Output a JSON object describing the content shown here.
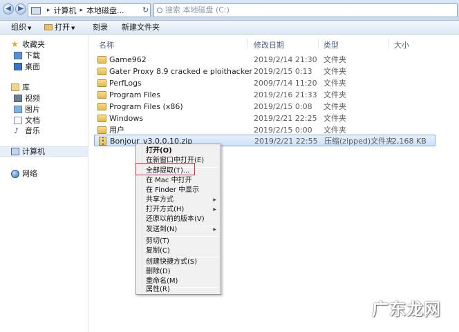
{
  "address_bar": {
    "path": [
      "计算机",
      "本地磁盘..."
    ],
    "search_placeholder": "搜索 本地磁盘 (C:)"
  },
  "toolbar": {
    "organize": "组织",
    "open": "打开",
    "burn": "刻录",
    "new_folder": "新建文件夹"
  },
  "nav": {
    "favorites": "收藏夹",
    "downloads": "下载",
    "desktop": "桌面",
    "libraries": "库",
    "videos": "视频",
    "pictures": "图片",
    "documents": "文档",
    "music": "音乐",
    "computer": "计算机",
    "network": "网络"
  },
  "columns": {
    "name": "名称",
    "date": "修改日期",
    "type": "类型",
    "size": "大小"
  },
  "files": [
    {
      "name": "Game962",
      "date": "2019/2/14 21:30",
      "type": "文件夹",
      "size": ""
    },
    {
      "name": "Gater Proxy 8.9 cracked e ploithacker",
      "date": "2019/2/15 0:13",
      "type": "文件夹",
      "size": ""
    },
    {
      "name": "PerfLogs",
      "date": "2009/7/14 11:20",
      "type": "文件夹",
      "size": ""
    },
    {
      "name": "Program Files",
      "date": "2019/2/16 21:33",
      "type": "文件夹",
      "size": ""
    },
    {
      "name": "Program Files (x86)",
      "date": "2019/2/15 0:08",
      "type": "文件夹",
      "size": ""
    },
    {
      "name": "Windows",
      "date": "2019/2/21 22:25",
      "type": "文件夹",
      "size": ""
    },
    {
      "name": "用户",
      "date": "2019/2/15 0:00",
      "type": "文件夹",
      "size": ""
    },
    {
      "name": "Bonjour_v3.0.0.10.zip",
      "date": "2019/2/21 22:55",
      "type": "压缩(zipped)文件夹",
      "size": "2,168 KB"
    }
  ],
  "context_menu": {
    "open": "打开(O)",
    "open_new_window": "在新窗口中打开(E)",
    "extract_all": "全部提取(T)...",
    "open_in_mac": "在 Mac 中打开",
    "show_in_finder": "在 Finder 中显示",
    "share_with": "共享方式",
    "open_with": "打开方式(H)",
    "restore_previous": "还原以前的版本(V)",
    "send_to": "发送到(N)",
    "cut": "剪切(T)",
    "copy": "复制(C)",
    "create_shortcut": "创建快捷方式(S)",
    "delete": "删除(D)",
    "rename": "重命名(M)",
    "properties": "属性(R)"
  },
  "watermark": "广东龙网",
  "colors": {
    "highlight_box": "#d63a3a",
    "selection": "#cfe2f8"
  }
}
